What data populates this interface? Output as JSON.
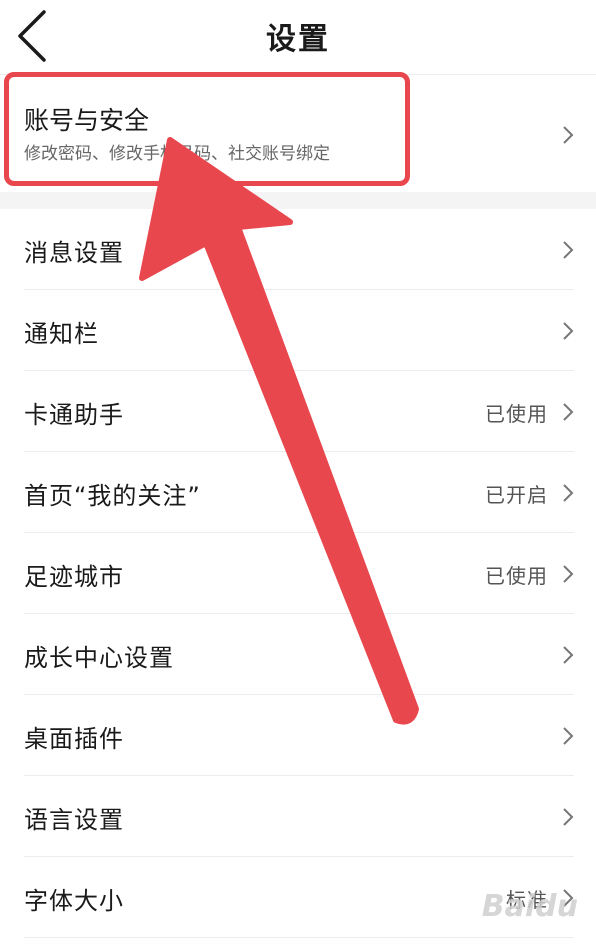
{
  "header": {
    "title": "设置"
  },
  "account": {
    "title": "账号与安全",
    "subtitle": "修改密码、修改手机号码、社交账号绑定"
  },
  "rows": [
    {
      "label": "消息设置",
      "value": ""
    },
    {
      "label": "通知栏",
      "value": ""
    },
    {
      "label": "卡通助手",
      "value": "已使用"
    },
    {
      "label": "首页“我的关注”",
      "value": "已开启"
    },
    {
      "label": "足迹城市",
      "value": "已使用"
    },
    {
      "label": "成长中心设置",
      "value": ""
    },
    {
      "label": "桌面插件",
      "value": ""
    },
    {
      "label": "语言设置",
      "value": ""
    },
    {
      "label": "字体大小",
      "value": "标准"
    }
  ],
  "watermark": {
    "text": "Baidu"
  },
  "colors": {
    "annotation": "#e8474e",
    "divider": "#ececec",
    "section_gap": "#f4f4f4"
  }
}
